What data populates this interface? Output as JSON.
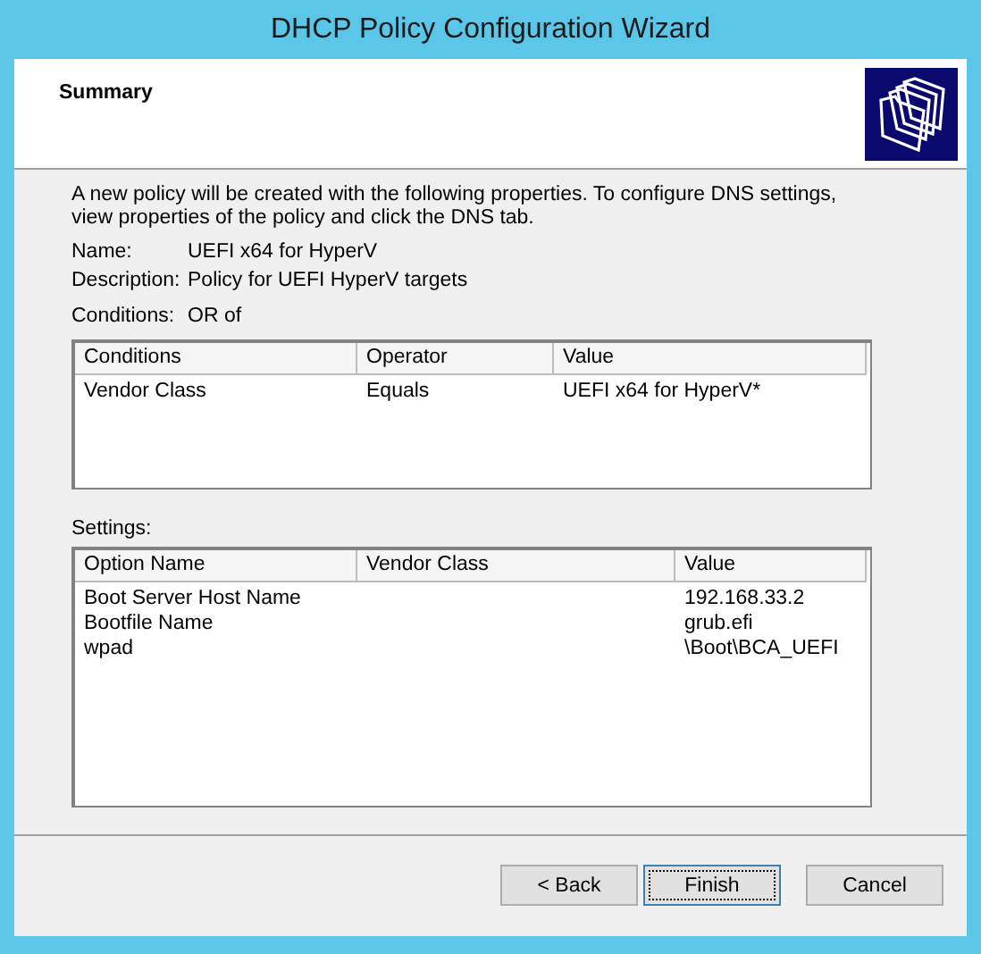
{
  "window": {
    "title": "DHCP Policy Configuration Wizard"
  },
  "header": {
    "title": "Summary"
  },
  "intro": "A new policy will be created with the following properties. To configure DNS settings, view properties of the policy and click the DNS tab.",
  "properties": [
    {
      "label": "Name:",
      "value": "UEFI x64 for HyperV"
    },
    {
      "label": "Description:",
      "value": "Policy for UEFI HyperV targets"
    }
  ],
  "conditions_line": {
    "label": "Conditions:",
    "value": "OR of"
  },
  "conditions_table": {
    "columns": [
      "Conditions",
      "Operator",
      "Value"
    ],
    "rows": [
      [
        "Vendor Class",
        "Equals",
        "UEFI x64 for HyperV*"
      ]
    ]
  },
  "settings_label": "Settings:",
  "settings_table": {
    "columns": [
      "Option Name",
      "Vendor Class",
      "Value"
    ],
    "rows": [
      [
        "Boot Server Host Name",
        "",
        "192.168.33.2"
      ],
      [
        "Bootfile Name",
        "",
        "grub.efi"
      ],
      [
        "wpad",
        "",
        "\\Boot\\BCA_UEFI"
      ]
    ]
  },
  "buttons": [
    {
      "label": "< Back",
      "default": false
    },
    {
      "label": "Finish",
      "default": true
    },
    {
      "label": "Cancel",
      "default": false
    }
  ]
}
